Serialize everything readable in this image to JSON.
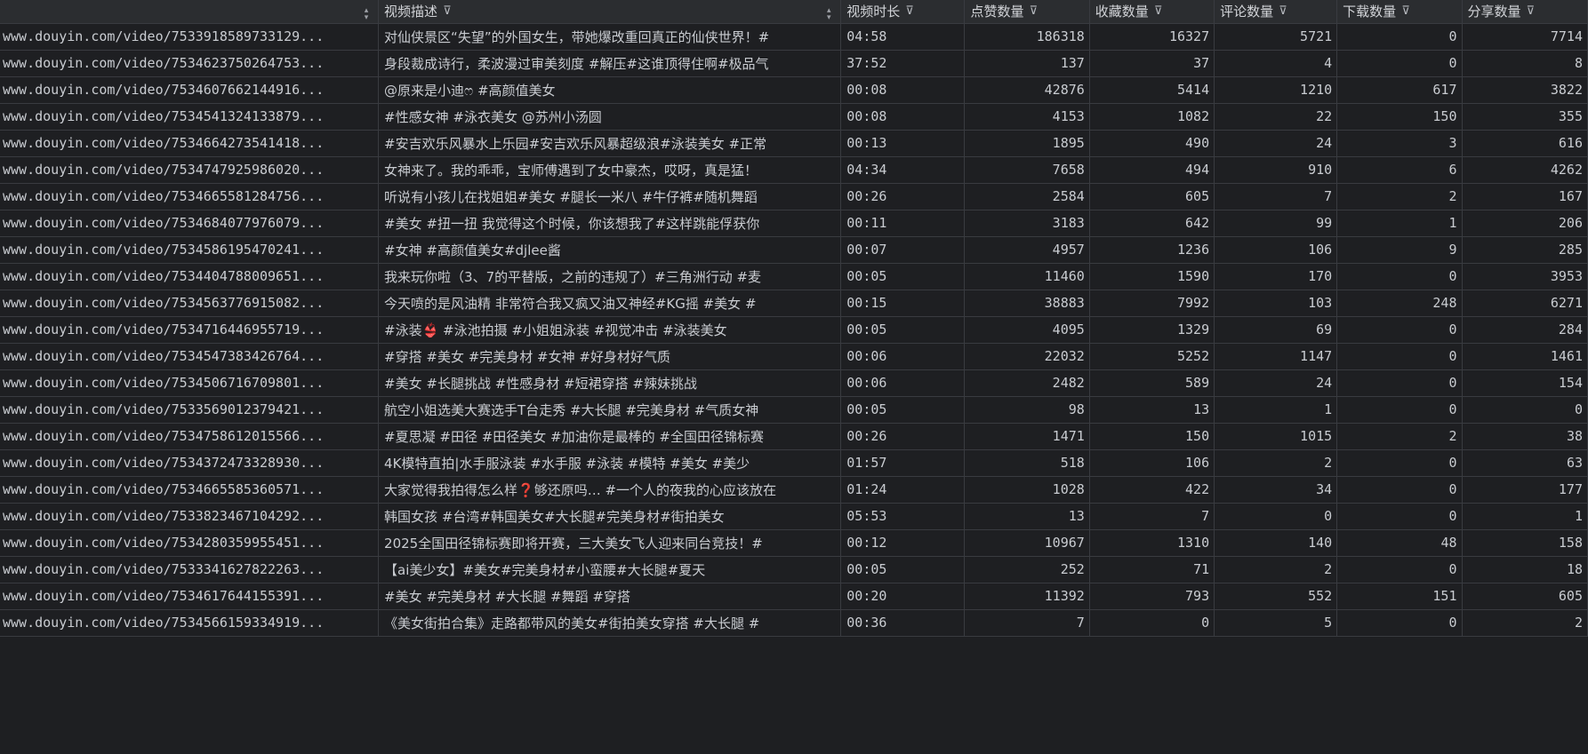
{
  "columns": [
    {
      "label": "",
      "filter": ""
    },
    {
      "label": "视频描述",
      "filter": "⊽"
    },
    {
      "label": "视频时长",
      "filter": "⊽"
    },
    {
      "label": "点赞数量",
      "filter": "⊽"
    },
    {
      "label": "收藏数量",
      "filter": "⊽"
    },
    {
      "label": "评论数量",
      "filter": "⊽"
    },
    {
      "label": "下载数量",
      "filter": "⊽"
    },
    {
      "label": "分享数量",
      "filter": "⊽"
    }
  ],
  "rows": [
    [
      "www.douyin.com/video/7533918589733129...",
      "对仙侠景区“失望”的外国女生，带她爆改重回真正的仙侠世界！#",
      "04:58",
      "186318",
      "16327",
      "5721",
      "0",
      "7714"
    ],
    [
      "www.douyin.com/video/7534623750264753...",
      "身段裁成诗行，柔波漫过审美刻度 #解压#这谁顶得住啊#极品气",
      "37:52",
      "137",
      "37",
      "4",
      "0",
      "8"
    ],
    [
      "www.douyin.com/video/7534607662144916...",
      "@原来是小迪ෆ #高颜值美女",
      "00:08",
      "42876",
      "5414",
      "1210",
      "617",
      "3822"
    ],
    [
      "www.douyin.com/video/7534541324133879...",
      "#性感女神  #泳衣美女 @苏州小汤圆",
      "00:08",
      "4153",
      "1082",
      "22",
      "150",
      "355"
    ],
    [
      "www.douyin.com/video/7534664273541418...",
      "#安吉欢乐风暴水上乐园#安吉欢乐风暴超级浪#泳装美女 #正常",
      "00:13",
      "1895",
      "490",
      "24",
      "3",
      "616"
    ],
    [
      "www.douyin.com/video/7534747925986020...",
      "女神来了。我的乖乖，宝师傅遇到了女中豪杰，哎呀，真是猛！",
      "04:34",
      "7658",
      "494",
      "910",
      "6",
      "4262"
    ],
    [
      "www.douyin.com/video/7534665581284756...",
      "听说有小孩儿在找姐姐#美女 #腿长一米八 #牛仔裤#随机舞蹈",
      "00:26",
      "2584",
      "605",
      "7",
      "2",
      "167"
    ],
    [
      "www.douyin.com/video/7534684077976079...",
      "#美女 #扭一扭 我觉得这个时候，你该想我了#这样跳能俘获你",
      "00:11",
      "3183",
      "642",
      "99",
      "1",
      "206"
    ],
    [
      "www.douyin.com/video/7534586195470241...",
      "#女神 #高颜值美女#djlee酱",
      "00:07",
      "4957",
      "1236",
      "106",
      "9",
      "285"
    ],
    [
      "www.douyin.com/video/7534404788009651...",
      "我来玩你啦（3、7的平替版，之前的违规了）#三角洲行动 #麦",
      "00:05",
      "11460",
      "1590",
      "170",
      "0",
      "3953"
    ],
    [
      "www.douyin.com/video/7534563776915082...",
      "今天喷的是风油精 非常符合我又疯又油又神经#KG摇 #美女 #",
      "00:15",
      "38883",
      "7992",
      "103",
      "248",
      "6271"
    ],
    [
      "www.douyin.com/video/7534716446955719...",
      "#泳装👙 #泳池拍摄 #小姐姐泳装 #视觉冲击 #泳装美女",
      "00:05",
      "4095",
      "1329",
      "69",
      "0",
      "284"
    ],
    [
      "www.douyin.com/video/7534547383426764...",
      "#穿搭 #美女 #完美身材 #女神 #好身材好气质",
      "00:06",
      "22032",
      "5252",
      "1147",
      "0",
      "1461"
    ],
    [
      "www.douyin.com/video/7534506716709801...",
      "#美女 #长腿挑战 #性感身材 #短裙穿搭 #辣妹挑战",
      "00:06",
      "2482",
      "589",
      "24",
      "0",
      "154"
    ],
    [
      "www.douyin.com/video/7533569012379421...",
      "航空小姐选美大赛选手T台走秀 #大长腿 #完美身材 #气质女神",
      "00:05",
      "98",
      "13",
      "1",
      "0",
      "0"
    ],
    [
      "www.douyin.com/video/7534758612015566...",
      "#夏思凝 #田径 #田径美女 #加油你是最棒的 #全国田径锦标赛",
      "00:26",
      "1471",
      "150",
      "1015",
      "2",
      "38"
    ],
    [
      "www.douyin.com/video/7534372473328930...",
      "4K模特直拍|水手服泳装 #水手服 #泳装 #模特 #美女 #美少",
      "01:57",
      "518",
      "106",
      "2",
      "0",
      "63"
    ],
    [
      "www.douyin.com/video/7534665585360571...",
      "大家觉得我拍得怎么样❓够还原吗… #一个人的夜我的心应该放在",
      "01:24",
      "1028",
      "422",
      "34",
      "0",
      "177"
    ],
    [
      "www.douyin.com/video/7533823467104292...",
      "韩国女孩 #台湾#韩国美女#大长腿#完美身材#街拍美女",
      "05:53",
      "13",
      "7",
      "0",
      "0",
      "1"
    ],
    [
      "www.douyin.com/video/7534280359955451...",
      "2025全国田径锦标赛即将开赛，三大美女飞人迎来同台竞技！#",
      "00:12",
      "10967",
      "1310",
      "140",
      "48",
      "158"
    ],
    [
      "www.douyin.com/video/7533341627822263...",
      "【ai美少女】#美女#完美身材#小蛮腰#大长腿#夏天",
      "00:05",
      "252",
      "71",
      "2",
      "0",
      "18"
    ],
    [
      "www.douyin.com/video/7534617644155391...",
      "#美女 #完美身材 #大长腿 #舞蹈 #穿搭",
      "00:20",
      "11392",
      "793",
      "552",
      "151",
      "605"
    ],
    [
      "www.douyin.com/video/7534566159334919...",
      "《美女街拍合集》走路都带风的美女#街拍美女穿搭 #大长腿 #",
      "00:36",
      "7",
      "0",
      "5",
      "0",
      "2"
    ]
  ]
}
